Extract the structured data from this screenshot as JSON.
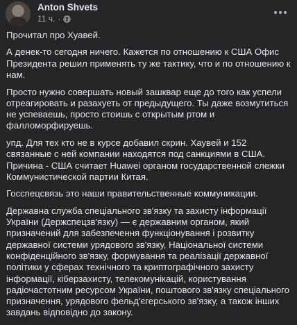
{
  "post": {
    "author": "Anton Shvets",
    "time": "11 ч.",
    "separator": "·",
    "privacy_icon": "globe-icon",
    "more_icon": "more-options-icon",
    "paragraphs": [
      "Прочитал про Хуавей.",
      "А денек-то сегодня ничего. Кажется по отношению к США Офис Президента решил применять ту же тактику, что и по отношению к нам.",
      "Просто нужно совершать новый зашквар еще до того как успели отреагировать и разахуеть от предыдущего. Ты даже возмутиться не успеваешь, просто стоишь с открытым ртом и фалломорфируешь.",
      "упд. Для тех кто не в курсе добавил скрин. Хаувей и 152 связанные с ней компании находятся под санкциями в США. Причина - США считает Huawei органом государственной слежки Коммунистической партии Китая.",
      "Госспецсвязь это наши правительственные коммуникации.",
      "Державна служба спеціального зв'язку та захисту інформації України (Держспецзв'язку) — є державним органом, який призначений для забезпечення функціонування і розвитку державної системи урядового зв'язку, Національної системи конфіденційного зв'язку, формування та реалізації державної політики у сферах технічного та криптографічного захисту інформації, кіберзахисту, телекомунікацій, користування радіочастотним ресурсом України, поштового зв'язку спеціального призначення, урядового фельд'єгерського зв'язку, а також інших завдань відповідно до закону."
    ]
  },
  "colors": {
    "background": "#242526",
    "primary_text": "#e4e6eb",
    "secondary_text": "#b0b3b8"
  }
}
